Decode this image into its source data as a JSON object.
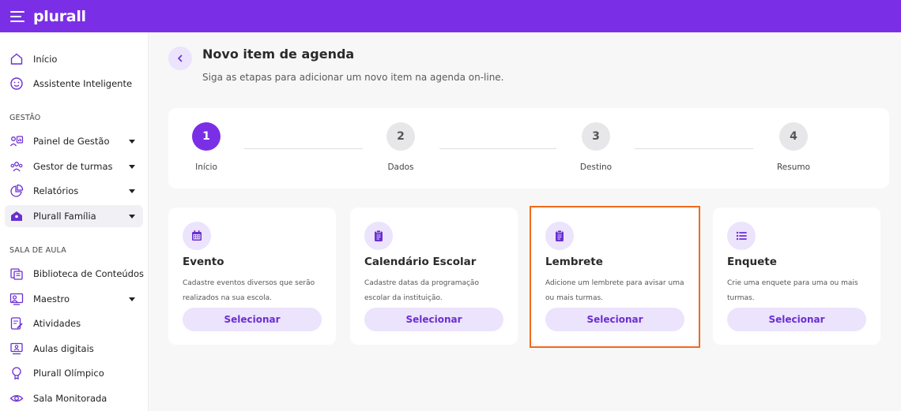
{
  "app": {
    "logo": "plurall"
  },
  "sidebar": {
    "top_items": [
      {
        "label": "Início",
        "icon": "home-icon"
      },
      {
        "label": "Assistente Inteligente",
        "icon": "smile-icon"
      }
    ],
    "section_gestao": "GESTÃO",
    "gestao_items": [
      {
        "label": "Painel de Gestão",
        "icon": "dashboard-icon"
      },
      {
        "label": "Gestor de turmas",
        "icon": "users-icon"
      },
      {
        "label": "Relatórios",
        "icon": "pie-chart-icon"
      },
      {
        "label": "Plurall Família",
        "icon": "family-icon"
      }
    ],
    "section_sala": "SALA DE AULA",
    "sala_items": [
      {
        "label": "Biblioteca de Conteúdos",
        "icon": "library-icon"
      },
      {
        "label": "Maestro",
        "icon": "maestro-icon"
      },
      {
        "label": "Atividades",
        "icon": "activities-icon"
      },
      {
        "label": "Aulas digitais",
        "icon": "monitor-icon"
      },
      {
        "label": "Plurall Olímpico",
        "icon": "medal-icon"
      },
      {
        "label": "Sala Monitorada",
        "icon": "eye-icon"
      }
    ]
  },
  "header": {
    "title": "Novo item de agenda",
    "subtitle": "Siga as etapas para adicionar um novo item na agenda on-line."
  },
  "stepper": {
    "steps": [
      {
        "number": "1",
        "label": "Início"
      },
      {
        "number": "2",
        "label": "Dados"
      },
      {
        "number": "3",
        "label": "Destino"
      },
      {
        "number": "4",
        "label": "Resumo"
      }
    ]
  },
  "cards": [
    {
      "title": "Evento",
      "description": "Cadastre eventos diversos que serão realizados na sua escola.",
      "button": "Selecionar",
      "icon": "calendar-icon"
    },
    {
      "title": "Calendário Escolar",
      "description": "Cadastre datas da programação escolar da instituição.",
      "button": "Selecionar",
      "icon": "clipboard-icon"
    },
    {
      "title": "Lembrete",
      "description": "Adicione um lembrete para avisar uma ou mais turmas.",
      "button": "Selecionar",
      "icon": "clipboard-icon"
    },
    {
      "title": "Enquete",
      "description": "Crie uma enquete para uma ou mais turmas.",
      "button": "Selecionar",
      "icon": "list-icon"
    }
  ],
  "colors": {
    "brand": "#7a2fe6",
    "accent_light": "#ece3fd",
    "highlight": "#f26a1b"
  }
}
